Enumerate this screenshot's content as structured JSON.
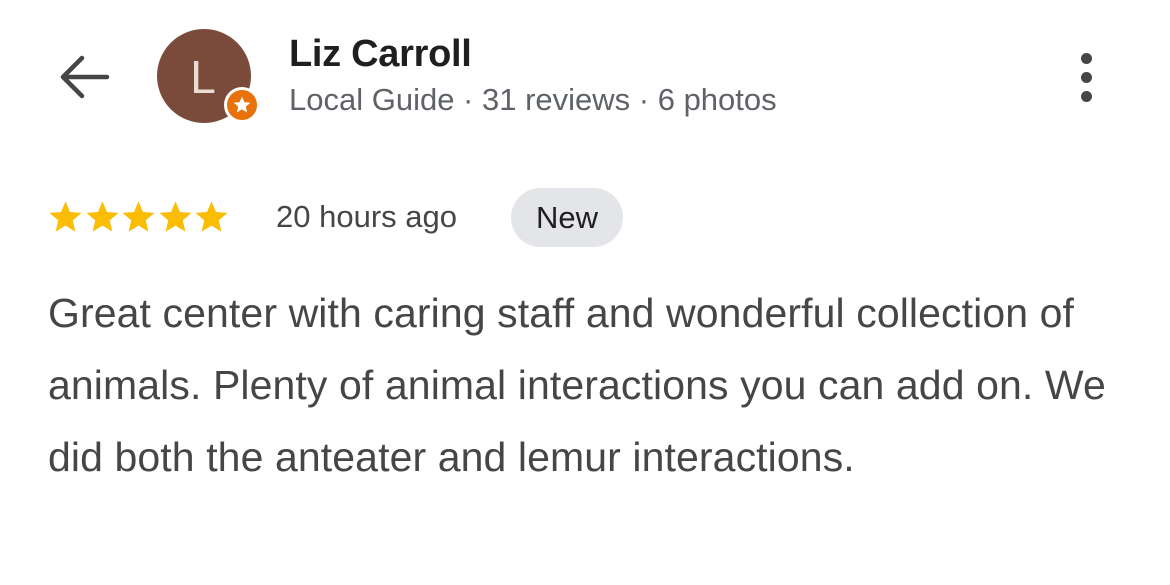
{
  "header": {
    "avatar_initial": "L",
    "name": "Liz Carroll",
    "meta": "Local Guide · 31 reviews · 6 photos"
  },
  "icons": {
    "back": "arrow-left-icon",
    "more": "more-vert-icon",
    "badge": "star-icon",
    "rating": "star-icon"
  },
  "colors": {
    "avatar_bg": "#7a4b3a",
    "star": "#fbbc04",
    "guide_badge": "#e8710a",
    "new_chip_bg": "#e3e5e8"
  },
  "review": {
    "rating": 5,
    "rating_max": 5,
    "time": "20 hours ago",
    "badge": "New",
    "text": "Great center with caring staff and wonderful collection of animals. Plenty of animal interactions you can add on. We did both the anteater and lemur interactions."
  }
}
